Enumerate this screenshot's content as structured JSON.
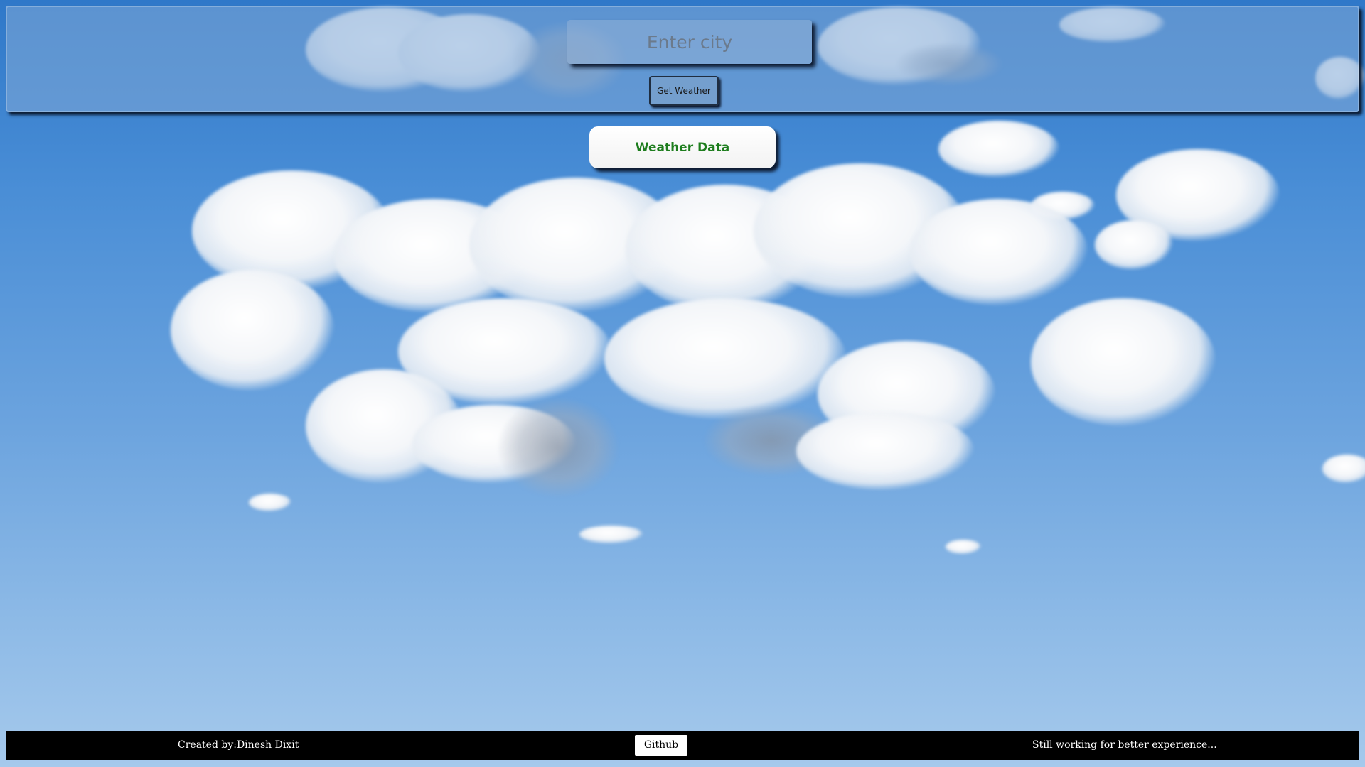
{
  "search": {
    "placeholder": "Enter city",
    "value": ""
  },
  "controls": {
    "get_weather_label": "Get Weather"
  },
  "weather_card": {
    "title": "Weather Data",
    "title_color": "#1d7d1d"
  },
  "footer": {
    "credit": "Created by:Dinesh Dixit",
    "github_label": "Github",
    "status": "Still working for better experience..."
  },
  "colors": {
    "sky_top": "#2f78c9",
    "sky_bottom": "#a5c9ec",
    "footer_bg": "#000000"
  }
}
